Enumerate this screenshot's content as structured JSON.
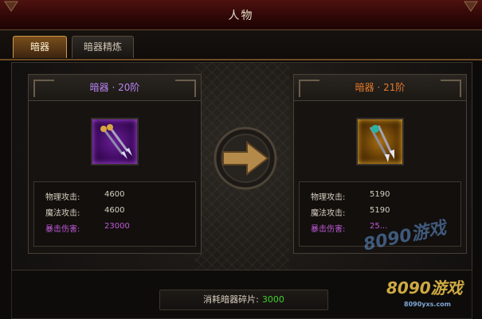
{
  "window": {
    "title": "人物"
  },
  "tabs": [
    {
      "label": "暗器",
      "active": true
    },
    {
      "label": "暗器精炼",
      "active": false
    }
  ],
  "current": {
    "title": "暗器 · 20阶",
    "title_color": "#b784f2",
    "icon": "purple-dart-weapon-icon",
    "stats": [
      {
        "label": "物理攻击:",
        "value": "4600"
      },
      {
        "label": "魔法攻击:",
        "value": "4600"
      },
      {
        "label": "暴击伤害:",
        "value": "23000"
      }
    ]
  },
  "next": {
    "title": "暗器 · 21阶",
    "title_color": "#e27a2c",
    "icon": "gold-dart-weapon-icon",
    "stats": [
      {
        "label": "物理攻击:",
        "value": "5190"
      },
      {
        "label": "魔法攻击:",
        "value": "5190"
      },
      {
        "label": "暴击伤害:",
        "value": "25..."
      }
    ]
  },
  "cost": {
    "label": "消耗暗器碎片:",
    "value": "3000"
  },
  "watermark": {
    "top": "8090",
    "brand": "游戏",
    "url": "8090yxs.com"
  },
  "colors": {
    "accent": "#c99a4c",
    "crit": "#c05ad8",
    "cost": "#3fd12a"
  }
}
